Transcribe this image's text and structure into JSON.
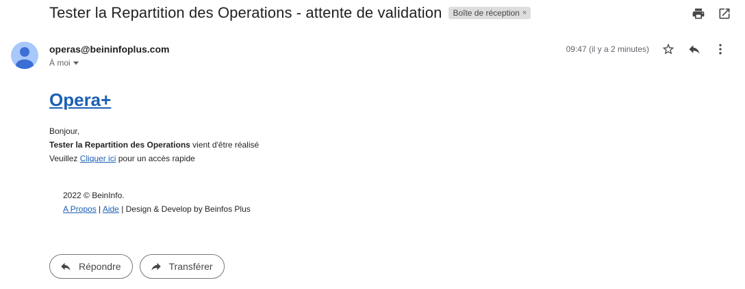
{
  "subject": "Tester la Repartition des Operations - attente de validation",
  "label_chip": {
    "text": "Boîte de réception",
    "close": "×"
  },
  "top_icons": [
    "print-icon",
    "open-in-new-window-icon"
  ],
  "sender": {
    "email": "operas@beininfoplus.com",
    "recipient": "À moi"
  },
  "timestamp": "09:47 (il y a 2 minutes)",
  "meta_icons": [
    "star-icon",
    "reply-icon",
    "more-vert-icon"
  ],
  "body": {
    "brand": "Opera+",
    "greeting": "Bonjour,",
    "line2_bold": "Tester la Repartition des Operations",
    "line2_rest": " vient d'être réalisé",
    "line3_prefix": "Veuillez ",
    "line3_link": "Cliquer ici",
    "line3_suffix": " pour un accès rapide"
  },
  "footer": {
    "copyright": "2022 © BeinInfo.",
    "link_about": "A Propos",
    "sep1": " | ",
    "link_help": "Aide",
    "sep2_text": " | Design & Develop by Beinfos Plus"
  },
  "actions": {
    "reply": "Répondre",
    "forward": "Transférer"
  }
}
